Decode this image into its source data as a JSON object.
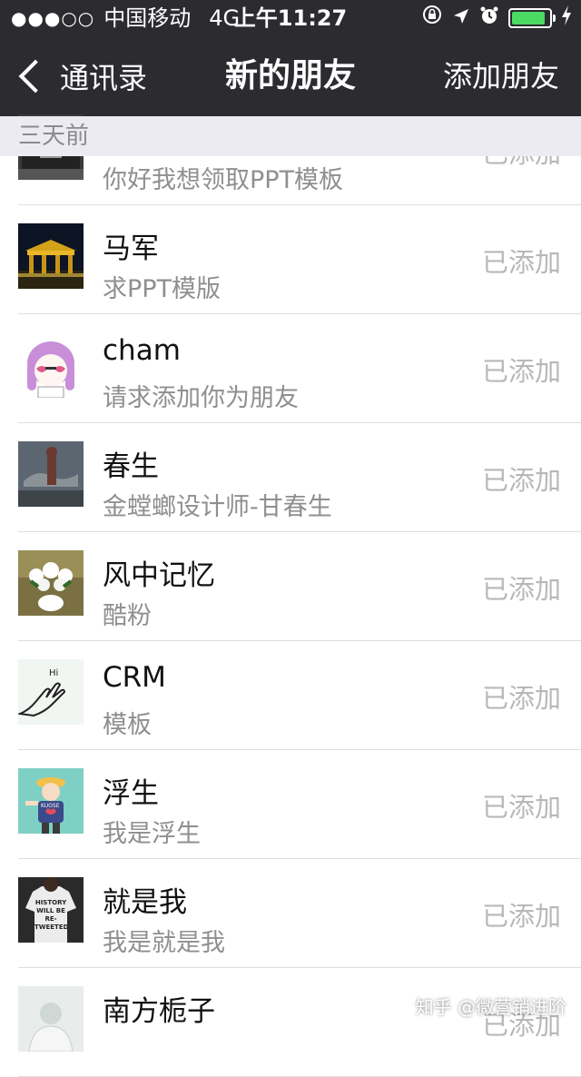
{
  "status_bar": {
    "signal": "●●●○○",
    "carrier": "中国移动",
    "network": "4G",
    "time": "上午11:27",
    "battery_level": 0.9,
    "battery_color": "#4cd964"
  },
  "nav": {
    "back_label": "通讯录",
    "title": "新的朋友",
    "action_label": "添加朋友"
  },
  "section": {
    "header": "三天前"
  },
  "friends": [
    {
      "name": "",
      "message": "你好我想领取PPT模板",
      "status": "已添加",
      "avatar": "building-photo-avatar"
    },
    {
      "name": "马军",
      "message": "求PPT模版",
      "status": "已添加",
      "avatar": "gate-night-avatar"
    },
    {
      "name": "cham",
      "message": "请求添加你为朋友",
      "status": "已添加",
      "avatar": "cartoon-girl-avatar"
    },
    {
      "name": "春生",
      "message": "金螳螂设计师-甘春生",
      "status": "已添加",
      "avatar": "sculpture-avatar"
    },
    {
      "name": "风中记忆",
      "message": "酷粉",
      "status": "已添加",
      "avatar": "flowers-avatar"
    },
    {
      "name": "CRM",
      "message": "模板",
      "status": "已添加",
      "avatar": "hand-hi-avatar"
    },
    {
      "name": "浮生",
      "message": "我是浮生",
      "status": "已添加",
      "avatar": "cartoon-boy-avatar"
    },
    {
      "name": "就是我",
      "message": "我是就是我",
      "status": "已添加",
      "avatar": "tshirt-avatar"
    },
    {
      "name": "南方栀子",
      "message": "",
      "status": "已添加",
      "avatar": "person-avatar"
    }
  ],
  "avatar_texts": {
    "hand_hi": "Hi",
    "cartoon_boy_shirt": "KUOSE",
    "tshirt": "HISTORY WILL BE RE-TWEETED"
  },
  "watermark": "知乎 @微营销进阶"
}
